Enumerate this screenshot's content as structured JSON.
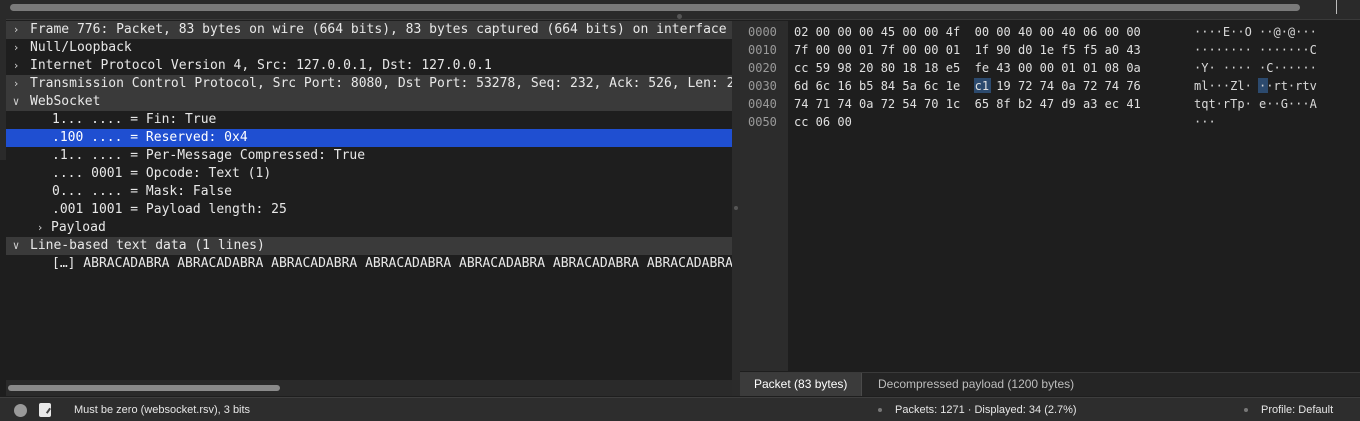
{
  "tree": [
    {
      "text": "Frame 776: Packet, 83 bytes on wire (664 bits), 83 bytes captured (664 bits) on interface",
      "arrow": ">",
      "level": 0,
      "state": "header"
    },
    {
      "text": "Null/Loopback",
      "arrow": ">",
      "level": 0,
      "state": ""
    },
    {
      "text": "Internet Protocol Version 4, Src: 127.0.0.1, Dst: 127.0.0.1",
      "arrow": ">",
      "level": 0,
      "state": ""
    },
    {
      "text": "Transmission Control Protocol, Src Port: 8080, Dst Port: 53278, Seq: 232, Ack: 526, Len: 2",
      "arrow": ">",
      "level": 0,
      "state": "header"
    },
    {
      "text": "WebSocket",
      "arrow": "v",
      "level": 0,
      "state": "header"
    },
    {
      "text": "1... .... = Fin: True",
      "arrow": "",
      "level": 2,
      "state": ""
    },
    {
      "text": ".100 .... = Reserved: 0x4",
      "arrow": "",
      "level": 2,
      "state": "selected"
    },
    {
      "text": ".1.. .... = Per-Message Compressed: True",
      "arrow": "",
      "level": 2,
      "state": ""
    },
    {
      "text": ".... 0001 = Opcode: Text (1)",
      "arrow": "",
      "level": 2,
      "state": ""
    },
    {
      "text": "0... .... = Mask: False",
      "arrow": "",
      "level": 2,
      "state": ""
    },
    {
      "text": ".001 1001 = Payload length: 25",
      "arrow": "",
      "level": 2,
      "state": ""
    },
    {
      "text": "Payload",
      "arrow": ">",
      "level": 1,
      "state": ""
    },
    {
      "text": "Line-based text data (1 lines)",
      "arrow": "v",
      "level": 0,
      "state": "header"
    },
    {
      "text": "[…] ABRACADABRA ABRACADABRA ABRACADABRA ABRACADABRA ABRACADABRA ABRACADABRA ABRACADABRA",
      "arrow": "",
      "level": 2,
      "state": ""
    }
  ],
  "bytes": [
    {
      "offset": "0000",
      "hex": "02 00 00 00 45 00 00 4f  00 00 40 00 40 06 00 00",
      "ascii": "····E··O ··@·@···"
    },
    {
      "offset": "0010",
      "hex": "7f 00 00 01 7f 00 00 01  1f 90 d0 1e f5 f5 a0 43",
      "ascii": "········ ·······C"
    },
    {
      "offset": "0020",
      "hex": "cc 59 98 20 80 18 18 e5  fe 43 00 00 01 01 08 0a",
      "ascii": "·Y· ···· ·C······"
    },
    {
      "offset": "0030",
      "hex": "6d 6c 16 b5 84 5a 6c 1e  c1 19 72 74 0a 72 74 76",
      "ascii": "ml···Zl· ··rt·rtv"
    },
    {
      "offset": "0040",
      "hex": "74 71 74 0a 72 54 70 1c  65 8f b2 47 d9 a3 ec 41",
      "ascii": "tqt·rTp· e··G···A"
    },
    {
      "offset": "0050",
      "hex": "cc 06 00",
      "ascii": "···"
    }
  ],
  "highlight": {
    "row": 3,
    "byte_index": 8
  },
  "bytes_tabs": [
    "Packet (83 bytes)",
    "Decompressed payload (1200 bytes)"
  ],
  "status": {
    "field_info": "Must be zero (websocket.rsv), 3 bits",
    "packets": "Packets: 1271 · Displayed: 34 (2.7%)",
    "profile": "Profile: Default"
  },
  "colors": {
    "selected_row": "#1f4fd1",
    "highlight_byte": "#2c4a6e",
    "header_row": "#3a3a3a"
  },
  "icons": {
    "expand": "chevron-right-icon",
    "collapse": "chevron-down-icon",
    "expert": "expert-info-icon",
    "comment": "packet-comment-icon"
  }
}
